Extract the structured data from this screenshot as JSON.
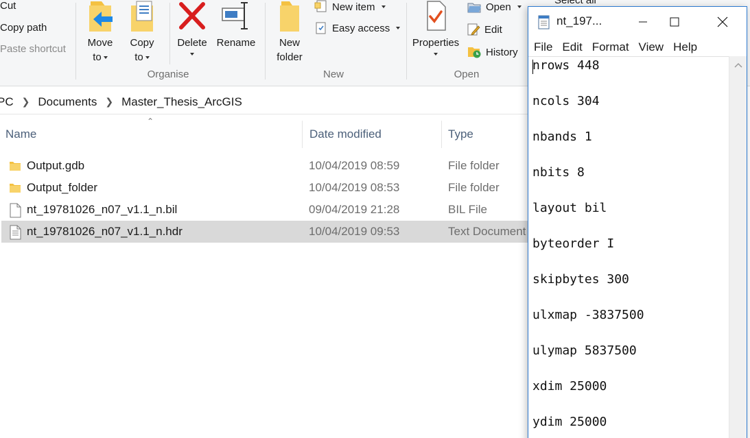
{
  "ribbon": {
    "clipboard": {
      "cut": "Cut",
      "copy_path": "Copy path",
      "paste_shortcut": "Paste shortcut"
    },
    "organise": {
      "move_to": [
        "Move",
        "to"
      ],
      "copy_to": [
        "Copy",
        "to"
      ],
      "delete": "Delete",
      "rename": "Rename",
      "label": "Organise"
    },
    "new": {
      "new_folder": [
        "New",
        "folder"
      ],
      "new_item": "New item",
      "easy_access": "Easy access",
      "label": "New"
    },
    "open": {
      "properties": "Properties",
      "open": "Open",
      "edit": "Edit",
      "history": "History",
      "label": "Open"
    },
    "select": {
      "select_all": "Select all"
    }
  },
  "address": {
    "crumbs": [
      "PC",
      "Documents",
      "Master_Thesis_ArcGIS"
    ]
  },
  "columns": {
    "name": "Name",
    "date": "Date modified",
    "type": "Type"
  },
  "files": [
    {
      "name": "Output.gdb",
      "date": "10/04/2019 08:59",
      "type": "File folder",
      "icon": "folder-icon"
    },
    {
      "name": "Output_folder",
      "date": "10/04/2019 08:53",
      "type": "File folder",
      "icon": "folder-icon"
    },
    {
      "name": "nt_19781026_n07_v1.1_n.bil",
      "date": "09/04/2019 21:28",
      "type": "BIL File",
      "icon": "file-icon"
    },
    {
      "name": "nt_19781026_n07_v1.1_n.hdr",
      "date": "10/04/2019 09:53",
      "type": "Text Document",
      "icon": "text-file-icon",
      "selected": true
    }
  ],
  "notepad": {
    "title": "nt_197...",
    "menu": [
      "File",
      "Edit",
      "Format",
      "View",
      "Help"
    ],
    "lines": [
      "nrows 448",
      "ncols 304",
      "nbands 1",
      "nbits 8",
      "layout bil",
      "byteorder I",
      "skipbytes 300",
      "ulxmap -3837500",
      "ulymap 5837500",
      "xdim 25000",
      "ydim 25000"
    ]
  },
  "colors": {
    "ribbon_bg": "#f5f6f7",
    "column_header": "#4c607a",
    "selected_row": "#d9d9d9",
    "folder": "#f4c142",
    "delete_red": "#d81e1e",
    "notepad_border": "#2b79d0"
  }
}
